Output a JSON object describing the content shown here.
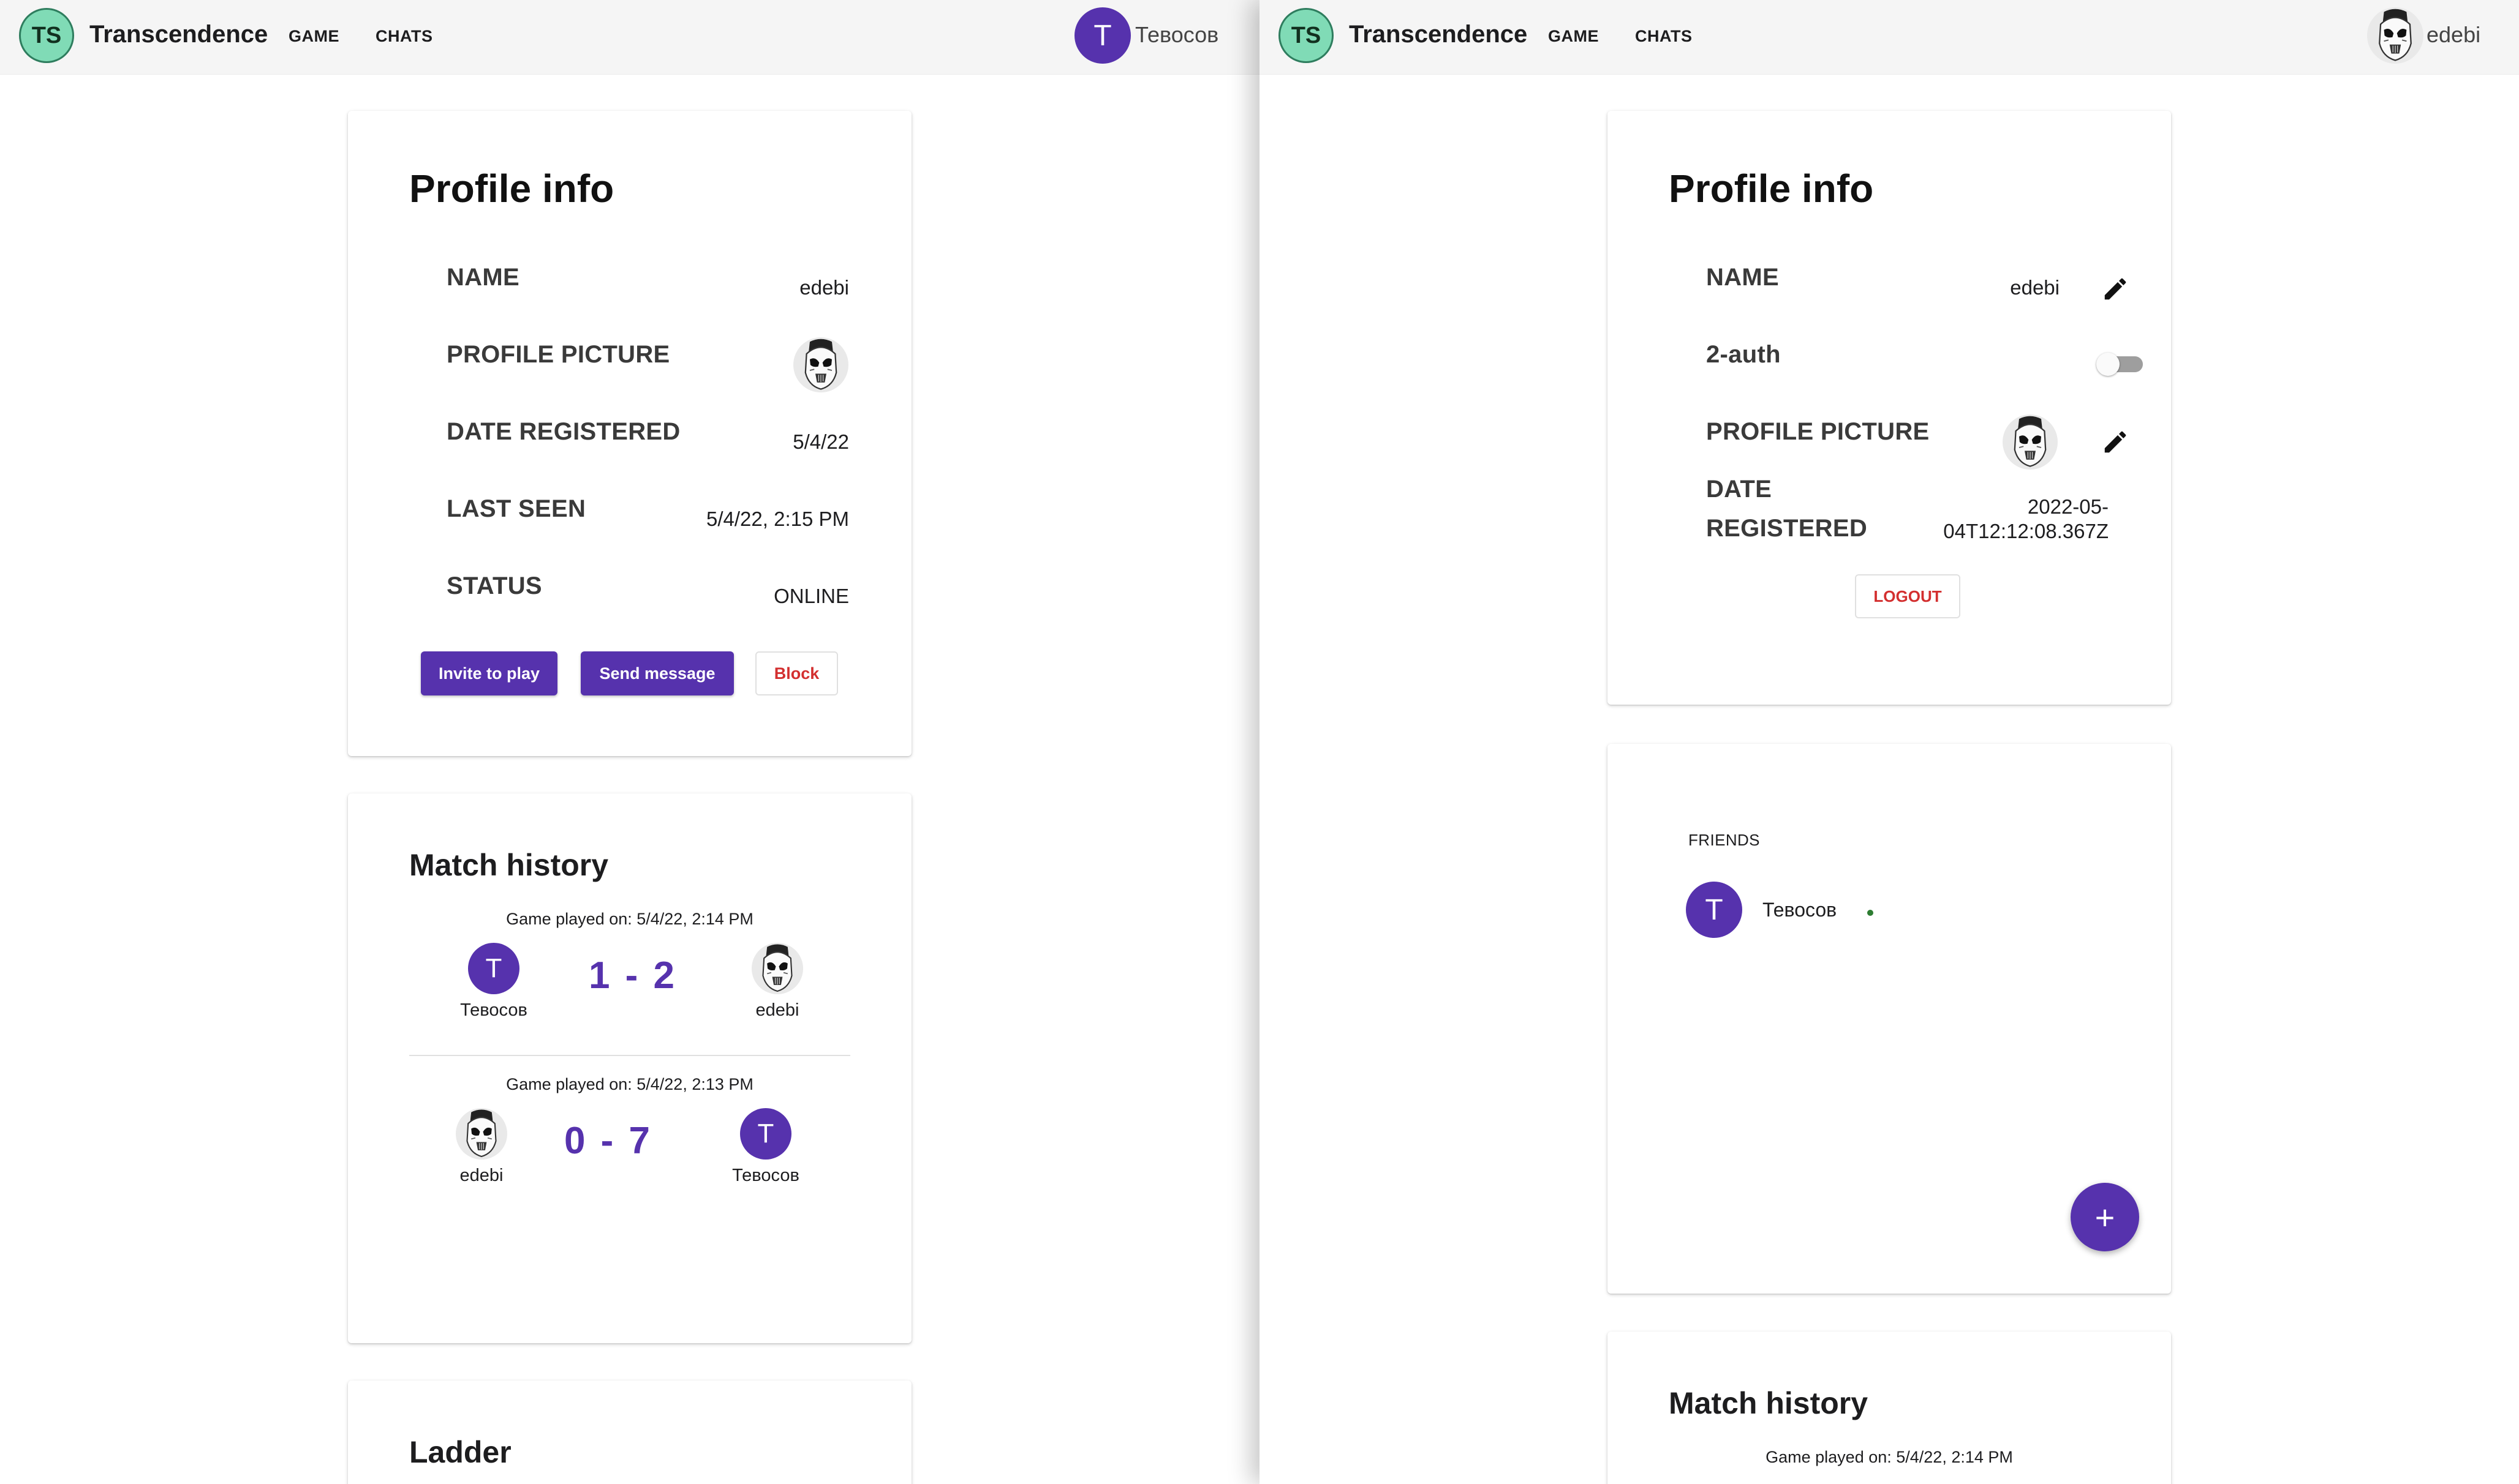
{
  "left": {
    "appbar": {
      "logo": "TS",
      "brand": "Transcendence",
      "nav": [
        "GAME",
        "CHATS"
      ],
      "user": {
        "initial": "T",
        "name": "Тевосов"
      }
    },
    "profile": {
      "title": "Profile info",
      "rows": [
        {
          "label": "NAME",
          "value": "edebi"
        },
        {
          "label": "PROFILE PICTURE",
          "value": ""
        },
        {
          "label": "DATE REGISTERED",
          "value": "5/4/22"
        },
        {
          "label": "LAST SEEN",
          "value": "5/4/22, 2:15 PM"
        },
        {
          "label": "STATUS",
          "value": "ONLINE"
        }
      ],
      "buttons": {
        "invite": "Invite to play",
        "message": "Send message",
        "block": "Block"
      }
    },
    "match_history": {
      "title": "Match history",
      "games": [
        {
          "date": "Game played on: 5/4/22, 2:14 PM",
          "score": "1 - 2",
          "left_player": "Тевосов",
          "right_player": "edebi",
          "left_initial": "T"
        },
        {
          "date": "Game played on: 5/4/22, 2:13 PM",
          "score": "0 - 7",
          "left_player": "edebi",
          "right_player": "Тевосов",
          "right_initial": "T"
        }
      ]
    },
    "ladder": {
      "title": "Ladder"
    }
  },
  "right": {
    "appbar": {
      "logo": "TS",
      "brand": "Transcendence",
      "nav": [
        "GAME",
        "CHATS"
      ],
      "user": {
        "name": "edebi"
      }
    },
    "profile": {
      "title": "Profile info",
      "name_label": "NAME",
      "name_value": "edebi",
      "twofa_label": "2-auth",
      "twofa_enabled": false,
      "picture_label": "PROFILE PICTURE",
      "date_label_line1": "DATE",
      "date_label_line2": "REGISTERED",
      "date_value_line1": "2022-05-",
      "date_value_line2": "04T12:12:08.367Z",
      "logout": "LOGOUT"
    },
    "friends": {
      "title": "FRIENDS",
      "items": [
        {
          "initial": "T",
          "name": "Тевосов",
          "status": "online"
        }
      ],
      "add_symbol": "+"
    },
    "match_history": {
      "title": "Match history",
      "first_date": "Game played on: 5/4/22, 2:14 PM"
    }
  },
  "colors": {
    "accent": "#5632ad",
    "logo_bg": "#80dbb6",
    "danger": "#d32f2f",
    "online": "#2e7d32"
  }
}
